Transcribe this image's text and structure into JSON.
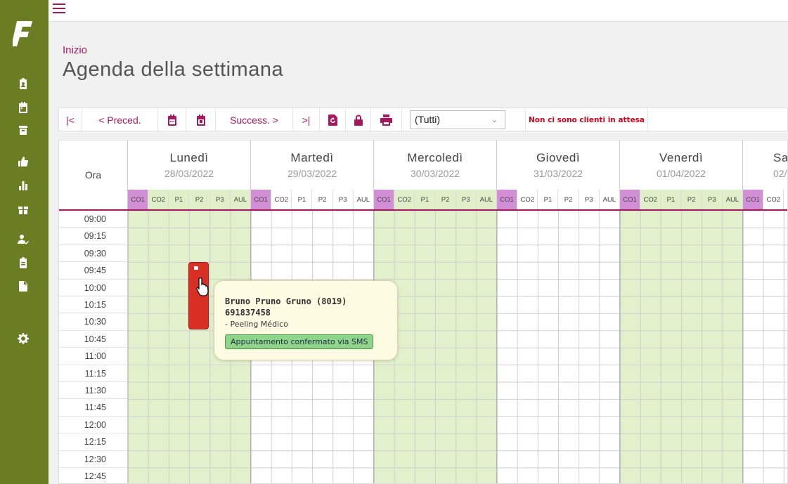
{
  "app": {
    "logo": "F"
  },
  "sidebar": {
    "items": [
      {
        "icon": "clipboard-user-icon"
      },
      {
        "icon": "calendar-icon"
      },
      {
        "icon": "archive-box-icon"
      },
      {
        "icon": "thumbs-up-icon"
      },
      {
        "icon": "bar-chart-icon"
      },
      {
        "icon": "gift-icon"
      },
      {
        "icon": "user-check-icon"
      },
      {
        "icon": "clipboard-list-icon"
      },
      {
        "icon": "document-icon"
      },
      {
        "icon": "settings-gear-icon"
      }
    ]
  },
  "header": {
    "breadcrumb": "Inizio",
    "title": "Agenda della settimana"
  },
  "toolbar": {
    "first_label": "|<",
    "prev_label": "< Preced.",
    "next_label": "Success. >",
    "last_label": ">|",
    "filter_value": "(Tutti)",
    "waiting_message": "Non ci sono clienti in attesa"
  },
  "calendar": {
    "time_header": "Ora",
    "days": [
      {
        "name": "Lunedì",
        "date": "28/03/2022"
      },
      {
        "name": "Martedì",
        "date": "29/03/2022"
      },
      {
        "name": "Mercoledì",
        "date": "30/03/2022"
      },
      {
        "name": "Giovedì",
        "date": "31/03/2022"
      },
      {
        "name": "Venerdì",
        "date": "01/04/2022"
      },
      {
        "name": "Sa",
        "date": "02/"
      }
    ],
    "resources": [
      "CO1",
      "CO2",
      "P1",
      "P2",
      "P3",
      "AUL"
    ],
    "last_day_resources": [
      "CO1",
      "CO2"
    ],
    "times": [
      "09:00",
      "09:15",
      "09:30",
      "09:45",
      "10:00",
      "10:15",
      "10:30",
      "10:45",
      "11:00",
      "11:15",
      "11:30",
      "11:45",
      "12:00",
      "12:15",
      "12:30",
      "12:45"
    ]
  },
  "appointment": {
    "color": "#d93025",
    "client": "Bruno Pruno Gruno (8019)",
    "phone": "691837458",
    "service": "- Peeling Médico",
    "status": "Appuntamento confermato via SMS"
  },
  "colors": {
    "accent": "#a5195f",
    "sidebar": "#6b7d22",
    "day_green": "#e2f0cb",
    "resource_co1": "#d38fd6",
    "alert": "#d0021b"
  }
}
